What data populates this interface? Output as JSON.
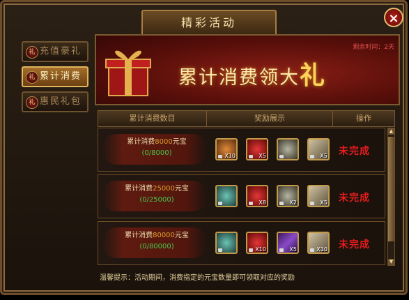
{
  "window": {
    "title": "精彩活动",
    "close_glyph": "×"
  },
  "sidebar": {
    "tabs": [
      {
        "label": "充值豪礼",
        "icon": "gift-icon",
        "active": false
      },
      {
        "label": "累计消费",
        "icon": "coin-icon",
        "active": true
      },
      {
        "label": "惠民礼包",
        "icon": "bag-icon",
        "active": false
      }
    ]
  },
  "banner": {
    "title_prefix": "累计消费领大",
    "title_big": "礼",
    "countdown": "剩余时间：2天"
  },
  "table": {
    "headers": [
      "累计消费数目",
      "奖励展示",
      "操作"
    ]
  },
  "rows": [
    {
      "prefix": "累计消费",
      "amount": "8000",
      "suffix": "元宝",
      "progress": "(0/8000)",
      "status": "未完成",
      "items": [
        {
          "name": "orb-item-icon",
          "qty": "X10",
          "color": "#b1652b"
        },
        {
          "name": "red-gem-item-icon",
          "qty": "X5",
          "color": "#b11f1f"
        },
        {
          "name": "silver-orb-item-icon",
          "qty": "",
          "color": "#8a8a80"
        },
        {
          "name": "scroll-item-icon",
          "qty": "X5",
          "color": "#9a8a6e"
        }
      ]
    },
    {
      "prefix": "累计消费",
      "amount": "25000",
      "suffix": "元宝",
      "progress": "(0/25000)",
      "status": "未完成",
      "items": [
        {
          "name": "armor-item-icon",
          "qty": "",
          "color": "#3c8a86"
        },
        {
          "name": "red-gem-item-icon",
          "qty": "X8",
          "color": "#b11f1f"
        },
        {
          "name": "silver-orb-item-icon",
          "qty": "X2",
          "color": "#8a8a80"
        },
        {
          "name": "scroll-item-icon",
          "qty": "X5",
          "color": "#9a8a6e"
        }
      ]
    },
    {
      "prefix": "累计消费",
      "amount": "80000",
      "suffix": "元宝",
      "progress": "(0/80000)",
      "status": "未完成",
      "items": [
        {
          "name": "armor-item-icon",
          "qty": "",
          "color": "#3c8a86"
        },
        {
          "name": "red-gem-item-icon",
          "qty": "X10",
          "color": "#b11f1f"
        },
        {
          "name": "purple-sword-item-icon",
          "qty": "X5",
          "color": "#6a2fa0"
        },
        {
          "name": "scroll-item-icon",
          "qty": "X10",
          "color": "#9a8a6e"
        }
      ]
    }
  ],
  "tip": {
    "label": "温馨提示：",
    "text": "活动期间，消费指定的元宝数量即可领取对应的奖励"
  },
  "scrollbar": {
    "up": "▲",
    "down": "▼"
  }
}
